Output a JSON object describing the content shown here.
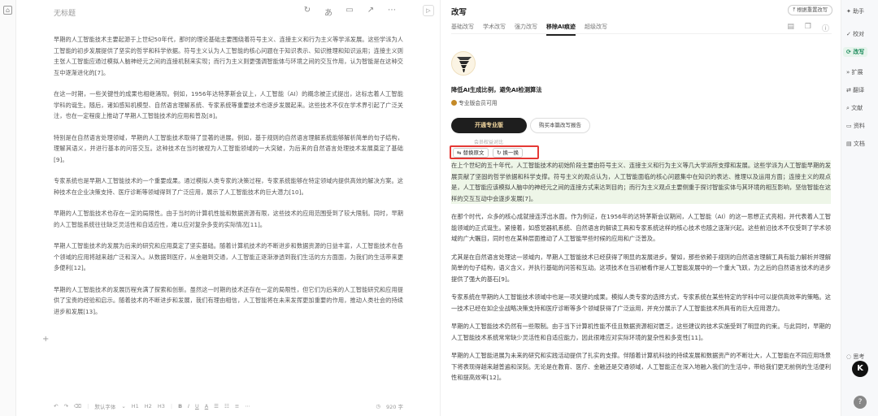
{
  "editor": {
    "title": "无标题",
    "top_icons": [
      "sync-icon",
      "translate-icon",
      "doc-icon",
      "share-icon",
      "more-icon"
    ],
    "paragraphs": [
      "早期的人工智能技术主要起源于上世纪50年代，那时的理论基础主要围绕着符号主义、连接主义和行为主义等学派发展。这些学派为人工智能的初步发展提供了坚实的哲学和科学依据。符号主义认为人工智能的核心问题在于知识表示、知识推理和知识运用；连接主义则主张人工智能应通过模拟人脑神经元之间的连接机制来实现；而行为主义则更强调智能体与环境之间的交互作用，认为智能是在这种交互中逐渐进化的[7]。",
      "在这一时期，一些关键性的成果也相继涌现。例如，1956年达特茅斯会议上，人工智能（AI）的概念被正式提出，这标志着人工智能学科的诞生。随后，诸如感知机模型、自然语言理解系统、专家系统等重要技术也逐步发展起来。这些技术不仅在学术界引起了广泛关注，也在一定程度上推动了早期人工智能技术的应用和普及[8]。",
      "特别是在自然语言处理领域，早期的人工智能技术取得了显著的进展。例如，基于规则的自然语言理解系统能够解析简单的句子结构，理解其语义，并进行基本的问答交互。这种技术在当时被视为人工智能领域的一大突破，为后来的自然语言处理技术发展奠定了基础[9]。",
      "专家系统也是早期人工智能技术的一个重要成果。通过模拟人类专家的决策过程，专家系统能够在特定领域内提供高效的解决方案。这种技术在企业决策支持、医疗诊断等领域得到了广泛应用，展示了人工智能技术的巨大潜力[10]。",
      "早期的人工智能技术也存在一定的局限性。由于当时的计算机性能和数据资源有限，这些技术的应用范围受到了较大限制。同时，早期的人工智能系统往往缺乏灵活性和自适应性，难以应对复杂多变的实际情况[11]。",
      "早期人工智能技术的发展为后来的研究和应用奠定了坚实基础。随着计算机技术的不断进步和数据资源的日益丰富，人工智能技术在各个领域的应用将越来越广泛和深入。从数据到医疗，从金融到交通，人工智能正逐渐渗透到我们生活的方方面面，为我们的生活带来更多便利[12]。",
      "早期的人工智能技术的发展历程充满了探索和创新。虽然这一时期的技术还存在一定的局限性，但它们为后来的人工智能研究和应用提供了宝贵的经验和启示。随着技术的不断进步和发展，我们有理由相信，人工智能将在未来发挥更加重要的作用，推动人类社会的持续进步和发展[13]。"
    ],
    "bottom": {
      "font": "默认字体",
      "headings": [
        "H1",
        "H2",
        "H3"
      ],
      "word_count": "920 字"
    }
  },
  "panel": {
    "title": "改写",
    "history_label": "根据重置改写",
    "tabs": [
      "基础改写",
      "学术改写",
      "强力改写",
      "移除AI痕迹",
      "超级改写"
    ],
    "active_tab": 3,
    "promo_title": "降低AI生成比例，避免AI检测算法",
    "promo_sub": "专业版会员可用",
    "btn_pro": "开通专业版",
    "btn_buy": "购买本篇改写报告",
    "rights_note": "会员权益对比",
    "btn_replace": "替换原文",
    "btn_swap": "换一换",
    "result_paragraphs": [
      "在上个世纪的五十年代，人工智能技术的初始阶段主要由符号主义、连接主义和行为主义等几大学派所支撑和发展。这些学派为人工智能早期的发展贡献了坚固的哲学依据和科学支撑。符号主义的观点认为，人工智能面临的核心问题集中在知识的表达、推理以及运用方面；连接主义的观点是，人工智能应该模拟人脑中的神经元之间的连接方式来达到目的；而行为主义观点主要侧重于探讨智能实体与其环境的相互影响，坚信智能在这样的交互互动中会逐步发展[7]。",
      "在那个时代，众多的核心成就接连浮出水面。作为例证，在1956年的达特茅斯会议期间，人工智能（AI）的这一思想正式亮相，并代表着人工智能领域的正式诞生。紧接着，如感觉器机系统、自然语言的解读工具和专家系统这样的核心技术也随之逐渐兴起。这些前沿技术不仅受到了学术领域的广大瞩目，同时也在某种层面推动了人工智能早些时候的应用和广泛普及。",
      "尤其是在自然语言处理这一领域内，早期人工智能技术已经获得了明显的发展进步。譬如，那些依赖于规则的自然语言理解工具有能力解析并理解简单的句子结构，语义含义，并执行基础的问答和互动。这项技术在当初被看作是人工智能发展中的一个重大飞跃，为之后的自然语言技术的进步提供了强大的基石[9]。",
      "专家系统在早期的人工智能技术领域中也是一项关键的成果。模拟人类专家的选择方式，专家系统在某些特定的学科中可以提供高效率的策略。这一技术已经在如企业战略决策支持和医疗诊断等多个领域获得了广泛运用，并充分展示了人工智能技术所具有的巨大应用潜力。",
      "早期的人工智能技术仍然有一些限制。由于当下计算机性能不佳且数据资源相对匮乏，这些建议的技术实施受到了明显的约束。与此同时，早期的人工智能技术系统常常缺少灵活性和自适应能力，因此很难应对实际环境的复杂性和多变性[11]。",
      "早期的人工智能进展为未来的研究和实践活动提供了扎实的支撑。伴随着计算机科技的持续发展和数据资产的不断壮大，人工智能在不同应用场景下将表现得越来越普遍和深刻。无论是在教育、医疗、金融还是交通领域，人工智能正在深入地融入我们的生活中，带给我们更无前例的生活便利性和提高效率[12]。"
    ]
  },
  "right_rail": {
    "items": [
      "助手",
      "校对",
      "改写",
      "扩展",
      "翻译",
      "文献",
      "资料",
      "文档"
    ],
    "active": 2,
    "bottom_items": [
      "思考"
    ],
    "badge_letter": "K",
    "help": "?"
  },
  "colors": {
    "accent_green": "#1b8a5a",
    "highlight_bg": "#eef6e8",
    "pro_button_bg": "#1e1e1e",
    "pro_button_text": "#f5d9a0",
    "selection_box": "#e53935"
  }
}
